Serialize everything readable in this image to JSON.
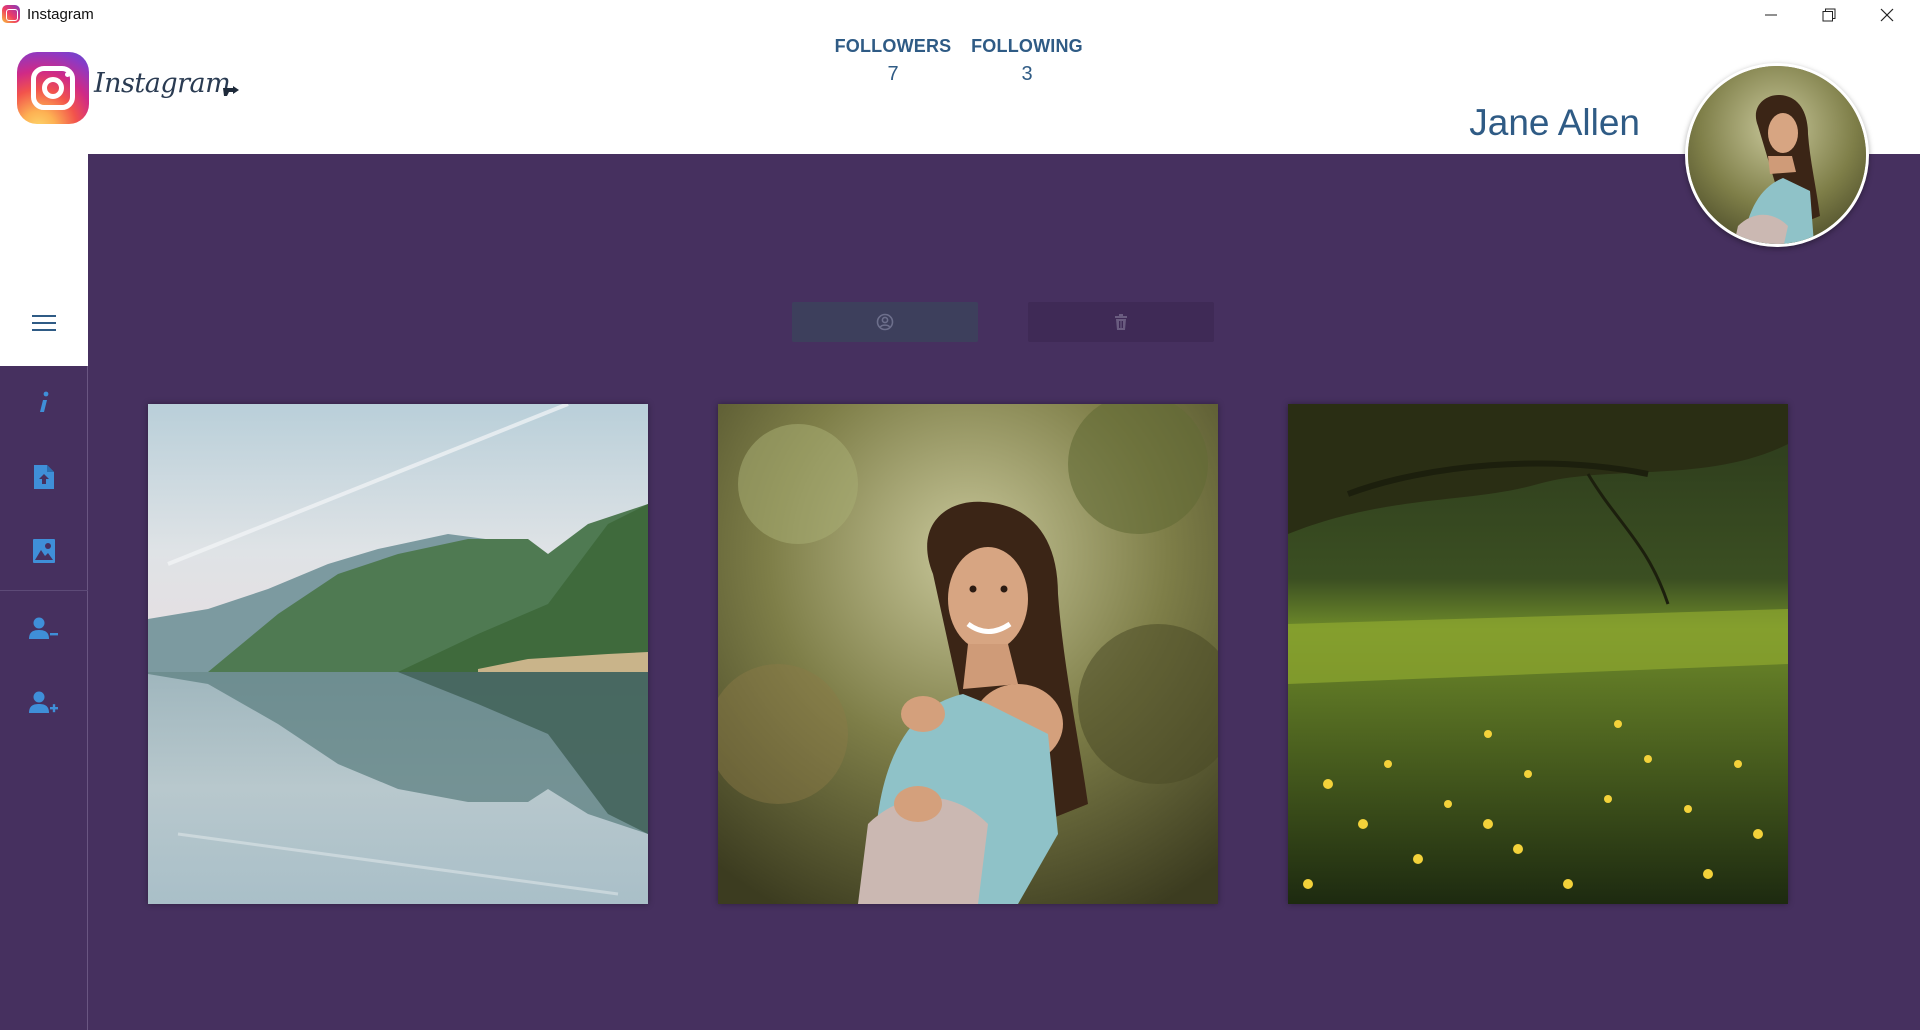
{
  "window": {
    "title": "Instagram",
    "app_icon": "instagram-icon"
  },
  "header": {
    "wordmark": "Instagram",
    "logo_icon": "instagram-logo-icon",
    "pointer_icon": "hand-pointer-icon",
    "followers_label": "FOLLOWERS",
    "followers_count": "7",
    "following_label": "FOLLOWING",
    "following_count": "3",
    "username": "Jane Allen"
  },
  "sidebar": {
    "menu_icon": "hamburger-menu-icon",
    "items": [
      {
        "icon": "info-icon"
      },
      {
        "icon": "upload-file-icon"
      },
      {
        "icon": "image-gallery-icon"
      },
      {
        "icon": "user-remove-icon"
      },
      {
        "icon": "user-add-icon"
      }
    ]
  },
  "actions": {
    "profile_icon": "user-circle-icon",
    "delete_icon": "trash-icon"
  },
  "photos": [
    {
      "subject": "lake-mountains"
    },
    {
      "subject": "portrait-woman"
    },
    {
      "subject": "meadow-dandelions"
    }
  ],
  "colors": {
    "main_background": "#46305f",
    "accent_text": "#2f5b85",
    "sidebar_icon": "#3f8fd8"
  }
}
